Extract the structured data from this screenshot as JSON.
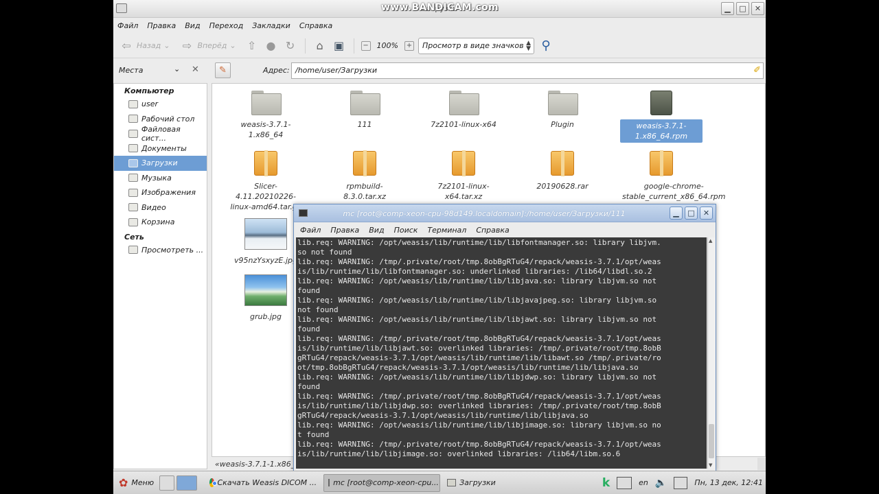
{
  "window": {
    "title": "Загрузки",
    "watermark": "www.BANDICAM.com",
    "buttons": {
      "minimize": "▁",
      "maximize": "□",
      "close": "✕"
    }
  },
  "menubar": [
    "Файл",
    "Правка",
    "Вид",
    "Переход",
    "Закладки",
    "Справка"
  ],
  "toolbar": {
    "back": "Назад",
    "forward": "Вперёд",
    "zoom": "100%",
    "zoom_minus": "−",
    "zoom_plus": "+",
    "view_mode": "Просмотр в виде значков"
  },
  "places": {
    "label": "Места",
    "address_label": "Адрес:",
    "address_value": "/home/user/Загрузки",
    "groups": [
      {
        "heading": "Компьютер",
        "items": [
          "user",
          "Рабочий стол",
          "Файловая сист...",
          "Документы",
          "Загрузки",
          "Музыка",
          "Изображения",
          "Видео",
          "Корзина"
        ]
      },
      {
        "heading": "Сеть",
        "items": [
          "Просмотреть ..."
        ]
      }
    ]
  },
  "files": [
    {
      "name": "weasis-3.7.1-1.x86_64",
      "type": "folder"
    },
    {
      "name": "111",
      "type": "folder"
    },
    {
      "name": "7z2101-linux-x64",
      "type": "folder"
    },
    {
      "name": "Plugin",
      "type": "folder"
    },
    {
      "name": "weasis-3.7.1-1.x86_64.rpm",
      "type": "rpm",
      "selected": true
    },
    {
      "name": "Slicer-4.11.20210226-linux-amd64.tar.gz",
      "type": "archive"
    },
    {
      "name": "rpmbuild-8.3.0.tar.xz",
      "type": "archive"
    },
    {
      "name": "7z2101-linux-x64.tar.xz",
      "type": "archive"
    },
    {
      "name": "20190628.rar",
      "type": "archive"
    },
    {
      "name": "google-chrome-stable_current_x86_64.rpm",
      "type": "archive"
    },
    {
      "name": "v95nzYsxyzE.jpg",
      "type": "image"
    },
    {
      "name": "grub.jpg",
      "type": "image"
    }
  ],
  "status_bar": "«weasis-3.7.1-1.x86_64",
  "terminal": {
    "title": "mc [root@comp-xeon-cpu-98d149.localdomain]:/home/user/Загрузки/111",
    "menu": [
      "Файл",
      "Правка",
      "Вид",
      "Поиск",
      "Терминал",
      "Справка"
    ],
    "lines": [
      "lib.req: WARNING: /opt/weasis/lib/runtime/lib/libfontmanager.so: library libjvm.",
      "so not found",
      "lib.req: WARNING: /tmp/.private/root/tmp.8obBgRTuG4/repack/weasis-3.7.1/opt/weas",
      "is/lib/runtime/lib/libfontmanager.so: underlinked libraries: /lib64/libdl.so.2",
      "lib.req: WARNING: /opt/weasis/lib/runtime/lib/libjava.so: library libjvm.so not",
      "found",
      "lib.req: WARNING: /opt/weasis/lib/runtime/lib/libjavajpeg.so: library libjvm.so",
      "not found",
      "lib.req: WARNING: /opt/weasis/lib/runtime/lib/libjawt.so: library libjvm.so not",
      "found",
      "lib.req: WARNING: /tmp/.private/root/tmp.8obBgRTuG4/repack/weasis-3.7.1/opt/weas",
      "is/lib/runtime/lib/libjawt.so: overlinked libraries: /tmp/.private/root/tmp.8obB",
      "gRTuG4/repack/weasis-3.7.1/opt/weasis/lib/runtime/lib/libawt.so /tmp/.private/ro",
      "ot/tmp.8obBgRTuG4/repack/weasis-3.7.1/opt/weasis/lib/runtime/lib/libjava.so",
      "lib.req: WARNING: /opt/weasis/lib/runtime/lib/libjdwp.so: library libjvm.so not",
      "found",
      "lib.req: WARNING: /tmp/.private/root/tmp.8obBgRTuG4/repack/weasis-3.7.1/opt/weas",
      "is/lib/runtime/lib/libjdwp.so: overlinked libraries: /tmp/.private/root/tmp.8obB",
      "gRTuG4/repack/weasis-3.7.1/opt/weasis/lib/runtime/lib/libjava.so",
      "lib.req: WARNING: /opt/weasis/lib/runtime/lib/libjimage.so: library libjvm.so no",
      "t found",
      "lib.req: WARNING: /tmp/.private/root/tmp.8obBgRTuG4/repack/weasis-3.7.1/opt/weas",
      "is/lib/runtime/lib/libjimage.so: overlinked libraries: /lib64/libm.so.6"
    ]
  },
  "taskbar": {
    "start": "Меню",
    "tasks": [
      "Скачать Weasis DICOM ...",
      "mc [root@comp-xeon-cpu...",
      "Загрузки"
    ],
    "lang": "en",
    "clock": "Пн, 13 дек, 12:41"
  }
}
